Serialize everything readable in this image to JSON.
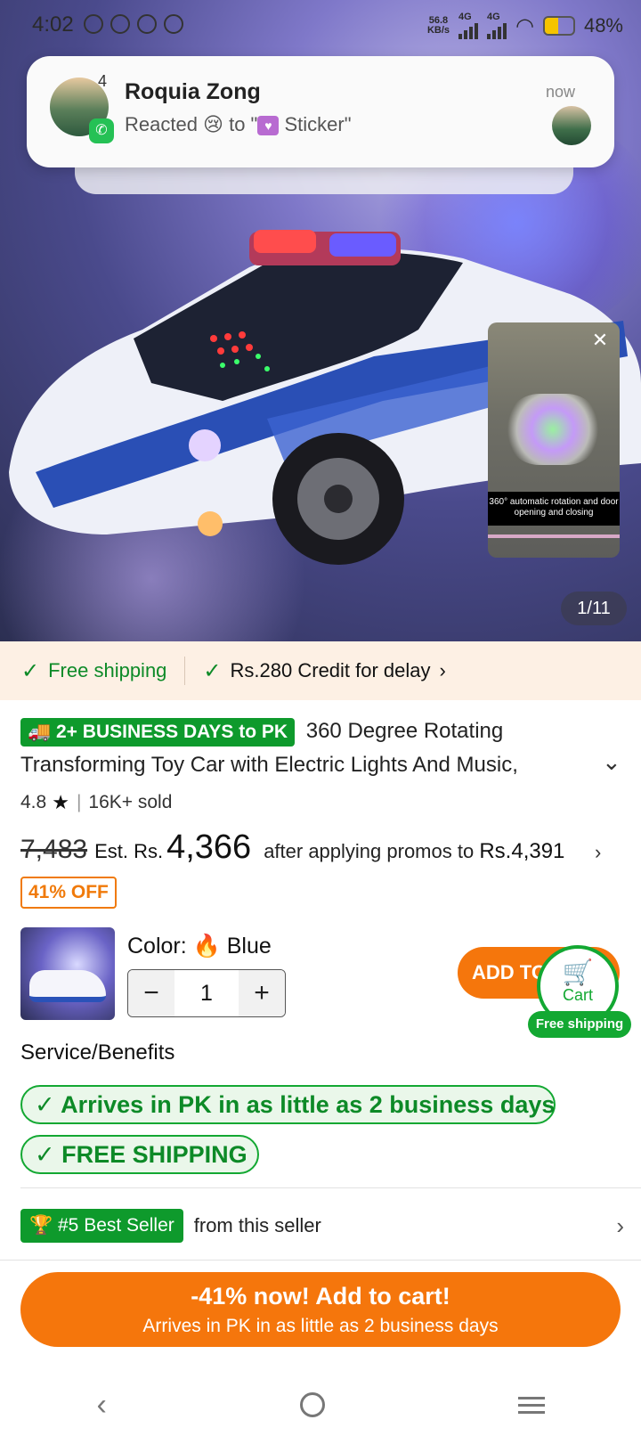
{
  "status_bar": {
    "time": "4:02",
    "net_speed": "56.8",
    "net_unit": "KB/s",
    "net1": "4G",
    "net2": "4G",
    "battery": "48%",
    "battery_level": 0.48
  },
  "notification": {
    "count": "4",
    "sender": "Roquia Zong",
    "message_prefix": "Reacted 😢 to \"",
    "sticker_label": "Sticker\"",
    "time": "now",
    "app_icon": "whatsapp-icon"
  },
  "gallery": {
    "video_caption": "360° automatic rotation and door opening and closing",
    "page_indicator": "1/11"
  },
  "shipping_strip": {
    "free_shipping": "Free shipping",
    "credit": "Rs.280 Credit for delay"
  },
  "product": {
    "delivery_badge": "2+ BUSINESS DAYS to PK",
    "title_line1": "360 Degree Rotating",
    "title_line2": "Transforming Toy Car with Electric Lights And Music,",
    "rating": "4.8",
    "sold": "16K+ sold",
    "old_price": "7,483",
    "est_label": "Est. Rs.",
    "price": "4,366",
    "after_label": "after applying promos to",
    "promo_price": "Rs.4,391",
    "discount": "41% OFF",
    "color_label": "Color:",
    "color_value": "Blue",
    "quantity": "1",
    "add_to_cart": "ADD TO CART",
    "cart_label": "Cart",
    "cart_free_shipping": "Free shipping"
  },
  "service": {
    "heading": "Service/Benefits",
    "benefit1": "Arrives in PK in as little as 2 business days",
    "benefit2": "FREE SHIPPING"
  },
  "seller": {
    "best_seller": "#5 Best Seller",
    "from": "from this seller"
  },
  "cta": {
    "line1": "-41% now! Add to cart!",
    "line2": "Arrives in PK in as little as 2 business days"
  },
  "colors": {
    "accent_orange": "#f5760c",
    "green": "#0e9a2c",
    "strip_bg": "#fdf0e4"
  }
}
